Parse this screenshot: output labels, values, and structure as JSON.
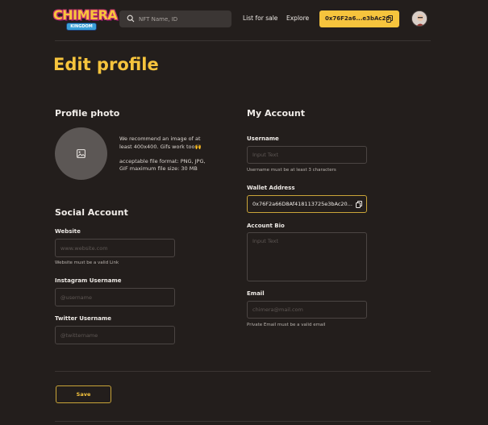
{
  "header": {
    "logo_text": "CHIMERA",
    "logo_sub": "KINGDOM",
    "search_placeholder": "NFT Name, ID",
    "nav": [
      "List for sale",
      "Explore"
    ],
    "wallet_short": "0x76F2a6...e3bAc20"
  },
  "page_title": "Edit profile",
  "profile_photo": {
    "title": "Profile photo",
    "recommend_line1": "We recommend an image of at",
    "recommend_line2": "least 400x400. Gifs work too🙌",
    "format_line1": "acceptable file format: PNG, JPG,",
    "format_line2": "GIF maximum file size: 30 MB"
  },
  "social": {
    "title": "Social Account",
    "website_label": "Website",
    "website_placeholder": "www.website.com",
    "website_helper": "Website must be a valid Link",
    "instagram_label": "Instagram Username",
    "instagram_placeholder": "@username",
    "twitter_label": "Twitter Username",
    "twitter_placeholder": "@twittername"
  },
  "account": {
    "title": "My Account",
    "username_label": "Username",
    "username_placeholder": "Input Text",
    "username_helper": "Username must be at least 3 characters",
    "wallet_label": "Wallet Address",
    "wallet_value": "0x76F2a66D8Af418113725e3bAc20...",
    "bio_label": "Account Bio",
    "bio_placeholder": "Input Text",
    "email_label": "Email",
    "email_placeholder": "chimera@mail.com",
    "email_helper": "Private Email must be a valid email"
  },
  "save_label": "Save",
  "colors": {
    "accent": "#f6c43d",
    "background": "#231e1c",
    "input_border": "#4b4543"
  }
}
